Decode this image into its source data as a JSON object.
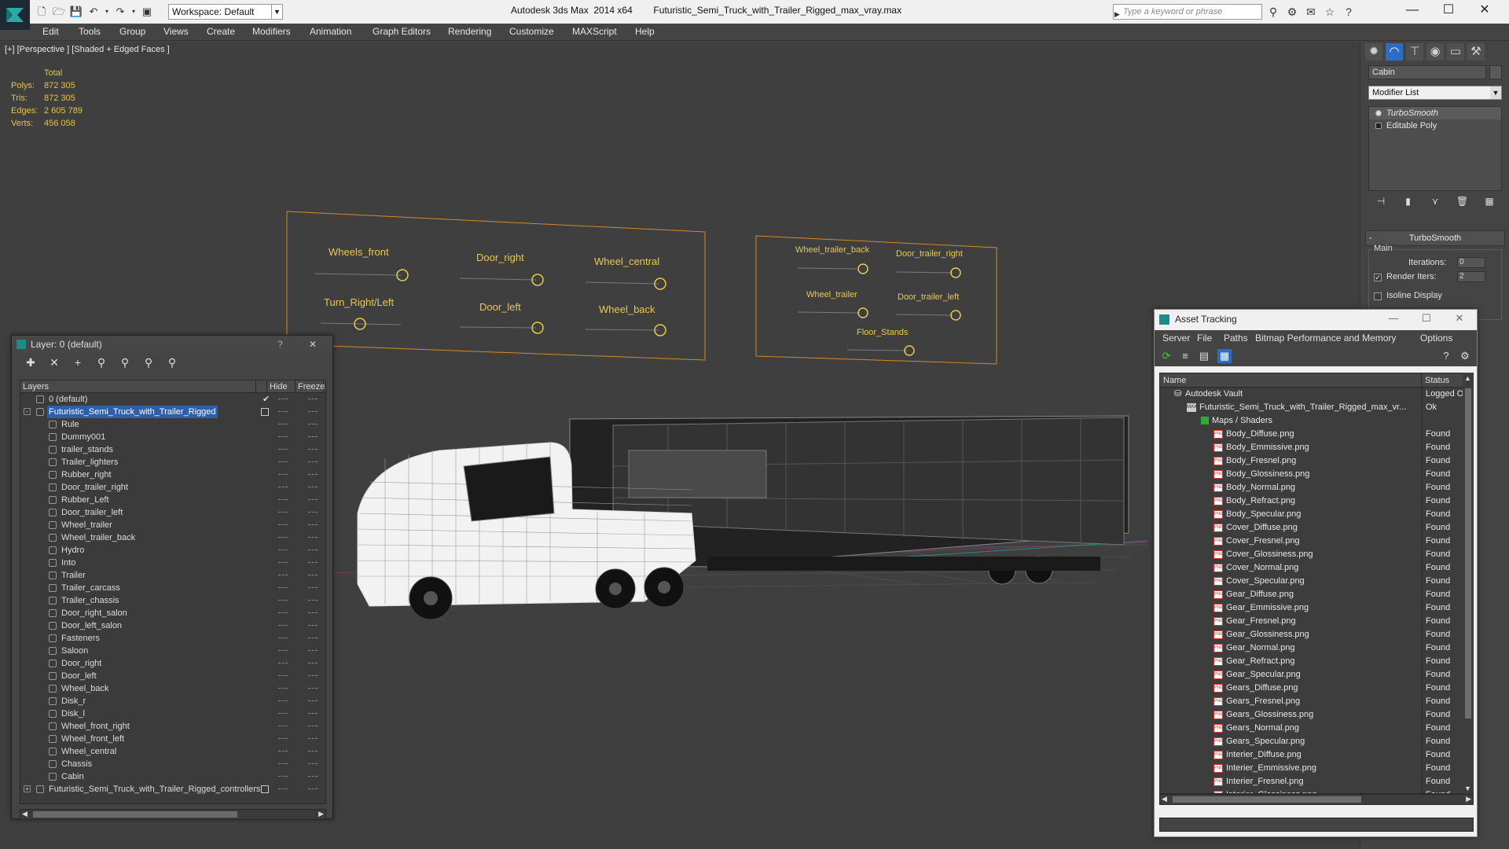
{
  "titlebar": {
    "workspace": "Workspace: Default",
    "app_title": "Autodesk 3ds Max  2014 x64        Futuristic_Semi_Truck_with_Trailer_Rigged_max_vray.max",
    "search_placeholder": "Type a keyword or phrase"
  },
  "menu": [
    "Edit",
    "Tools",
    "Group",
    "Views",
    "Create",
    "Modifiers",
    "Animation",
    "Graph Editors",
    "Rendering",
    "Customize",
    "MAXScript",
    "Help"
  ],
  "viewport": {
    "label": "[+] [Perspective ] [Shaded + Edged Faces ]",
    "stats": {
      "header": "Total",
      "rows": [
        {
          "k": "Polys:",
          "v": "872 305"
        },
        {
          "k": "Tris:",
          "v": "872 305"
        },
        {
          "k": "Edges:",
          "v": "2 605 789"
        },
        {
          "k": "Verts:",
          "v": "456 058"
        }
      ]
    },
    "controllers_left": [
      "Wheels_front",
      "Door_right",
      "Wheel_central",
      "Turn_Right/Left",
      "Door_left",
      "Wheel_back"
    ],
    "controllers_right": [
      "Wheel_trailer_back",
      "Door_trailer_right",
      "Wheel_trailer",
      "Door_trailer_left",
      "Floor_Stands"
    ]
  },
  "command_panel": {
    "object_name": "Cabin",
    "modifier_list": "Modifier List",
    "stack": [
      "TurboSmooth",
      "Editable Poly"
    ],
    "rollout_title": "TurboSmooth",
    "group_main": "Main",
    "iterations_label": "Iterations:",
    "iterations_value": "0",
    "render_iters_label": "Render Iters:",
    "render_iters_value": "2",
    "isoline_label": "Isoline Display"
  },
  "layer_window": {
    "title": "Layer: 0 (default)",
    "col_layers": "Layers",
    "col_hide": "Hide",
    "col_freeze": "Freeze",
    "top_layers": [
      "0 (default)",
      "Futuristic_Semi_Truck_with_Trailer_Rigged"
    ],
    "objects": [
      "Rule",
      "Dummy001",
      "trailer_stands",
      "Trailer_lighters",
      "Rubber_right",
      "Door_trailer_right",
      "Rubber_Left",
      "Door_trailer_left",
      "Wheel_trailer",
      "Wheel_trailer_back",
      "Hydro",
      "Into",
      "Trailer",
      "Trailer_carcass",
      "Trailer_chassis",
      "Door_right_salon",
      "Door_left_salon",
      "Fasteners",
      "Saloon",
      "Door_right",
      "Door_left",
      "Wheel_back",
      "Disk_r",
      "Disk_l",
      "Wheel_front_right",
      "Wheel_front_left",
      "Wheel_central",
      "Chassis",
      "Cabin"
    ],
    "bottom_layer": "Futuristic_Semi_Truck_with_Trailer_Rigged_controllers"
  },
  "asset_window": {
    "title": "Asset Tracking",
    "menu": [
      "Server",
      "File",
      "Paths",
      "Bitmap Performance and Memory",
      "Options"
    ],
    "col_name": "Name",
    "col_status": "Status",
    "vault": {
      "name": "Autodesk Vault",
      "status": "Logged O"
    },
    "scene_file": {
      "name": "Futuristic_Semi_Truck_with_Trailer_Rigged_max_vr...",
      "status": "Ok"
    },
    "maps_folder": "Maps / Shaders",
    "maps": [
      {
        "name": "Body_Diffuse.png",
        "status": "Found"
      },
      {
        "name": "Body_Emmissive.png",
        "status": "Found"
      },
      {
        "name": "Body_Fresnel.png",
        "status": "Found"
      },
      {
        "name": "Body_Glossiness.png",
        "status": "Found"
      },
      {
        "name": "Body_Normal.png",
        "status": "Found"
      },
      {
        "name": "Body_Refract.png",
        "status": "Found"
      },
      {
        "name": "Body_Specular.png",
        "status": "Found"
      },
      {
        "name": "Cover_Diffuse.png",
        "status": "Found"
      },
      {
        "name": "Cover_Fresnel.png",
        "status": "Found"
      },
      {
        "name": "Cover_Glossiness.png",
        "status": "Found"
      },
      {
        "name": "Cover_Normal.png",
        "status": "Found"
      },
      {
        "name": "Cover_Specular.png",
        "status": "Found"
      },
      {
        "name": "Gear_Diffuse.png",
        "status": "Found"
      },
      {
        "name": "Gear_Emmissive.png",
        "status": "Found"
      },
      {
        "name": "Gear_Fresnel.png",
        "status": "Found"
      },
      {
        "name": "Gear_Glossiness.png",
        "status": "Found"
      },
      {
        "name": "Gear_Normal.png",
        "status": "Found"
      },
      {
        "name": "Gear_Refract.png",
        "status": "Found"
      },
      {
        "name": "Gear_Specular.png",
        "status": "Found"
      },
      {
        "name": "Gears_Diffuse.png",
        "status": "Found"
      },
      {
        "name": "Gears_Fresnel.png",
        "status": "Found"
      },
      {
        "name": "Gears_Glossiness.png",
        "status": "Found"
      },
      {
        "name": "Gears_Normal.png",
        "status": "Found"
      },
      {
        "name": "Gears_Specular.png",
        "status": "Found"
      },
      {
        "name": "Interier_Diffuse.png",
        "status": "Found"
      },
      {
        "name": "Interier_Emmissive.png",
        "status": "Found"
      },
      {
        "name": "Interier_Fresnel.png",
        "status": "Found"
      },
      {
        "name": "Interier_Glossiness.png",
        "status": "Found"
      }
    ]
  },
  "colors": {
    "accent": "#2d6cc4",
    "stats_text": "#e2c24f",
    "controller_outline": "#d28a2a",
    "viewport_bg": "#3f3f3f"
  }
}
